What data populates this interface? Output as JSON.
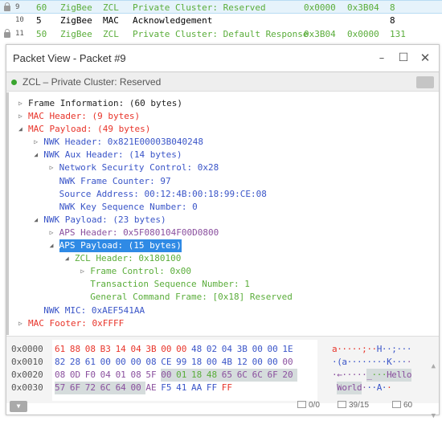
{
  "packet_list": [
    {
      "no": "9",
      "len": "60",
      "proto": "ZigBee",
      "type": "ZCL",
      "summary": "Private Cluster: Reserved",
      "src": "0x0000",
      "dst": "0x3B04",
      "count": "8",
      "locked": true,
      "selected": true,
      "color": "green"
    },
    {
      "no": "10",
      "len": "5",
      "proto": "ZigBee",
      "type": "MAC",
      "summary": "Acknowledgement",
      "src": "",
      "dst": "",
      "count": "8",
      "locked": false,
      "selected": false,
      "color": "black"
    },
    {
      "no": "11",
      "len": "50",
      "proto": "ZigBee",
      "type": "ZCL",
      "summary": "Private Cluster: Default Response",
      "src": "0x3B04",
      "dst": "0x0000",
      "count": "131",
      "locked": true,
      "selected": false,
      "color": "green"
    }
  ],
  "window": {
    "title": "Packet View - Packet #9",
    "status": "ZCL – Private Cluster: Reserved",
    "status_color": "#3aa52f"
  },
  "tree": [
    {
      "text": "Frame Information: (60 bytes)",
      "level": 0,
      "state": "collapsed",
      "color": "black"
    },
    {
      "text": "MAC Header: (9 bytes)",
      "level": 0,
      "state": "collapsed",
      "color": "red"
    },
    {
      "text": "MAC Payload: (49 bytes)",
      "level": 0,
      "state": "expanded",
      "color": "red"
    },
    {
      "text": "NWK Header: 0x821E00003B040248",
      "level": 1,
      "state": "collapsed",
      "color": "blue"
    },
    {
      "text": "NWK Aux Header: (14 bytes)",
      "level": 1,
      "state": "expanded",
      "color": "blue"
    },
    {
      "text": "Network Security Control: 0x28",
      "level": 2,
      "state": "collapsed",
      "color": "blue"
    },
    {
      "text": "NWK Frame Counter: 97",
      "level": 2,
      "state": "leaf",
      "color": "blue"
    },
    {
      "text": "Source Address: 00:12:4B:00:18:99:CE:08",
      "level": 2,
      "state": "leaf",
      "color": "blue"
    },
    {
      "text": "NWK Key Sequence Number: 0",
      "level": 2,
      "state": "leaf",
      "color": "blue"
    },
    {
      "text": "NWK Payload: (23 bytes)",
      "level": 1,
      "state": "expanded",
      "color": "blue"
    },
    {
      "text": "APS Header: 0x5F080104F00D0800",
      "level": 2,
      "state": "collapsed",
      "color": "purple"
    },
    {
      "text": "APS Payload: (15 bytes)",
      "level": 2,
      "state": "expanded",
      "color": "purple",
      "selected": true
    },
    {
      "text": "ZCL Header: 0x180100",
      "level": 3,
      "state": "expanded",
      "color": "zgreen"
    },
    {
      "text": "Frame Control: 0x00",
      "level": 4,
      "state": "collapsed",
      "color": "zgreen"
    },
    {
      "text": "Transaction Sequence Number: 1",
      "level": 4,
      "state": "leaf",
      "color": "zgreen"
    },
    {
      "text": "General Command Frame: [0x18] Reserved",
      "level": 4,
      "state": "leaf",
      "color": "zgreen"
    },
    {
      "text": "NWK MIC: 0xAEF541AA",
      "level": 1,
      "state": "leaf",
      "color": "blue"
    },
    {
      "text": "MAC Footer: 0xFFFF",
      "level": 0,
      "state": "collapsed",
      "color": "red"
    }
  ],
  "hex": {
    "offsets": [
      "0x0000",
      "0x0010",
      "0x0020",
      "0x0030"
    ],
    "bytes": [
      "61",
      "88",
      "08",
      "B3",
      "14",
      "04",
      "3B",
      "00",
      "00",
      "48",
      "02",
      "04",
      "3B",
      "00",
      "00",
      "1E",
      "82",
      "28",
      "61",
      "00",
      "00",
      "00",
      "08",
      "CE",
      "99",
      "18",
      "00",
      "4B",
      "12",
      "00",
      "00",
      "00",
      "08",
      "0D",
      "F0",
      "04",
      "01",
      "08",
      "5F",
      "00",
      "01",
      "18",
      "48",
      "65",
      "6C",
      "6C",
      "6F",
      "20",
      "57",
      "6F",
      "72",
      "6C",
      "64",
      "00",
      "AE",
      "F5",
      "41",
      "AA",
      "FF",
      "FF"
    ],
    "ascii": "a·····;··H··;····(a········K·····←·····_···Hello World···A··",
    "byte_colors": "rrrrrrrrrbbbbbbbbbbbbbbbbbbbbbbpppppppppgggppppppppppppbbbbrr",
    "selection_start": 39,
    "selection_length": 15
  },
  "footer": {
    "selection": "0/0",
    "position": "39/15",
    "length": "60"
  },
  "colors": {
    "red": "#e8342a",
    "blue": "#3a55c8",
    "purple": "#8a4f9e",
    "green": "#5aad3a",
    "selection": "#2f8ae5"
  }
}
